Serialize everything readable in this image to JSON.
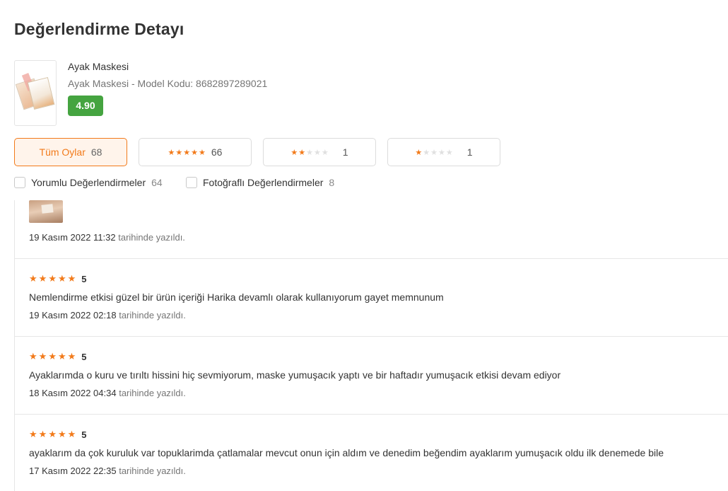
{
  "page": {
    "title": "Değerlendirme Detayı"
  },
  "product": {
    "name": "Ayak Maskesi",
    "subtitle": "Ayak Maskesi - Model Kodu: 8682897289021",
    "score": "4.90"
  },
  "filters": [
    {
      "label": "Tüm Oylar",
      "count": "68",
      "active": true
    },
    {
      "stars": 5,
      "count": "66"
    },
    {
      "stars": 2,
      "count": "1"
    },
    {
      "stars": 1,
      "count": "1"
    }
  ],
  "checkboxes": [
    {
      "label": "Yorumlu Değerlendirmeler",
      "count": "64"
    },
    {
      "label": "Fotoğraflı Değerlendirmeler",
      "count": "8"
    }
  ],
  "written_suffix": "tarihinde yazıldı.",
  "reviews": [
    {
      "date": "19 Kasım 2022 11:32"
    },
    {
      "rating": "5",
      "stars": 5,
      "text": "Nemlendirme etkisi güzel bir ürün içeriği Harika devamlı olarak kullanıyorum gayet memnunum",
      "date": "19 Kasım 2022 02:18"
    },
    {
      "rating": "5",
      "stars": 5,
      "text": "Ayaklarımda o kuru ve tırıltı hissini hiç sevmiyorum, maske yumuşacık yaptı ve bir haftadır yumuşacık etkisi devam ediyor",
      "date": "18 Kasım 2022 04:34"
    },
    {
      "rating": "5",
      "stars": 5,
      "text": "ayaklarım da çok kuruluk var topuklarimda çatlamalar mevcut onun için aldım ve denedim beğendim ayaklarım yumuşacık oldu ilk denemede bile",
      "date": "17 Kasım 2022 22:35"
    }
  ],
  "colors": {
    "accent": "#f27a1a",
    "score_badge": "#45a440"
  }
}
